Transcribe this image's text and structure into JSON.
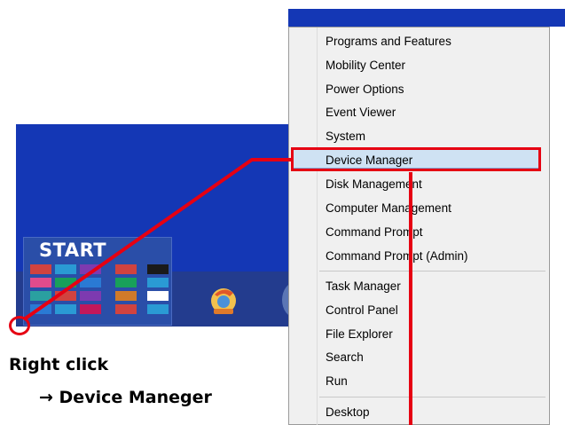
{
  "start_label": "START",
  "context_menu": {
    "group1": [
      "Programs and Features",
      "Mobility Center",
      "Power Options",
      "Event Viewer",
      "System",
      "Device Manager",
      "Disk Management",
      "Computer Management",
      "Command Prompt",
      "Command Prompt (Admin)"
    ],
    "group2": [
      "Task Manager",
      "Control Panel",
      "File Explorer",
      "Search",
      "Run"
    ],
    "group3": [
      "Desktop"
    ],
    "highlighted": "Device Manager"
  },
  "instructions": {
    "line1": "Right click",
    "line2": "→ Device Maneger"
  },
  "colors": {
    "desktop_blue": "#1437b5",
    "highlight_red": "#e60012",
    "menu_bg": "#f0f0f0",
    "menu_highlight": "#cfe2f3"
  },
  "icons": {
    "taskbar_app": "internet-explorer-icon"
  }
}
